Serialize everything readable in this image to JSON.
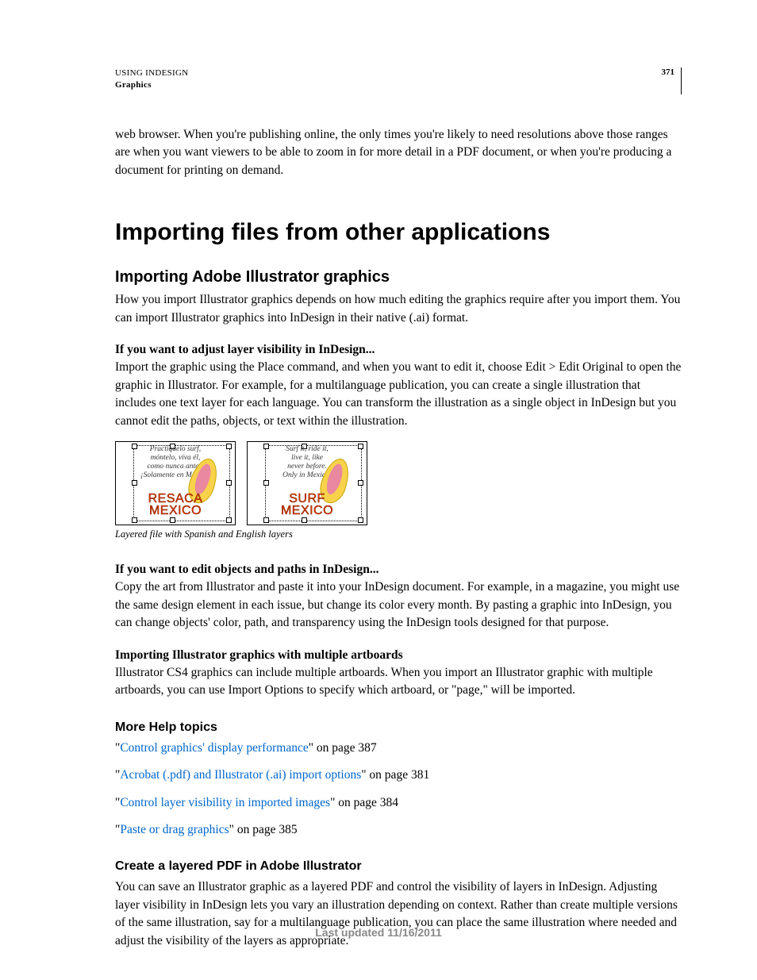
{
  "header": {
    "line1": "USING INDESIGN",
    "line2": "Graphics",
    "page_number": "371"
  },
  "intro_paragraph": "web browser. When you're publishing online, the only times you're likely to need resolutions above those ranges are when you want viewers to be able to zoom in for more detail in a PDF document, or when you're producing a document for printing on demand.",
  "h1": "Importing files from other applications",
  "h2_1": "Importing Adobe Illustrator graphics",
  "p_h2_1": "How you import Illustrator graphics depends on how much editing the graphics require after you import them. You can import Illustrator graphics into InDesign in their native (.ai) format.",
  "lead1": "If you want to adjust layer visibility in InDesign...",
  "p_lead1": "Import the graphic using the Place command, and when you want to edit it, choose Edit > Edit Original to open the graphic in Illustrator. For example, for a multilanguage publication, you can create a single illustration that includes one text layer for each language. You can transform the illustration as a single object in InDesign but you cannot edit the paths, objects, or text within the illustration.",
  "figure": {
    "left": {
      "lines": "Practíquelo surf,\nmóntelo, viva él,\ncomo nunca antes.\n¡Solamente en México!",
      "logo1": "RESACA",
      "logo2": "MEXICO"
    },
    "right": {
      "lines": "Surf it, ride it,\nlive it, like\nnever before.\nOnly in Mexico!",
      "logo1": "SURF",
      "logo2": "MEXICO"
    },
    "caption": "Layered file with Spanish and English layers"
  },
  "lead2": "If you want to edit objects and paths in InDesign...",
  "p_lead2": "Copy the art from Illustrator and paste it into your InDesign document. For example, in a magazine, you might use the same design element in each issue, but change its color every month. By pasting a graphic into InDesign, you can change objects' color, path, and transparency using the InDesign tools designed for that purpose.",
  "lead3": "Importing Illustrator graphics with multiple artboards",
  "p_lead3": "Illustrator CS4 graphics can include multiple artboards. When you import an Illustrator graphic with multiple artboards, you can use Import Options to specify which artboard, or \"page,\" will be imported.",
  "more_help": {
    "title": "More Help topics",
    "items": [
      {
        "pre": "\"",
        "link": "Control graphics' display performance",
        "post": "\" on page 387"
      },
      {
        "pre": "\"",
        "link": "Acrobat (.pdf) and Illustrator (.ai) import options",
        "post": "\" on page 381"
      },
      {
        "pre": "\"",
        "link": "Control layer visibility in imported images",
        "post": "\" on page 384"
      },
      {
        "pre": "\"",
        "link": "Paste or drag graphics",
        "post": "\" on page 385"
      }
    ]
  },
  "h3_2": "Create a layered PDF in Adobe Illustrator",
  "p_h3_2": "You can save an Illustrator graphic as a layered PDF and control the visibility of layers in InDesign. Adjusting layer visibility in InDesign lets you vary an illustration depending on context. Rather than create multiple versions of the same illustration, say for a multilanguage publication, you can place the same illustration where needed and adjust the visibility of the layers as appropriate.",
  "footer": "Last updated 11/16/2011"
}
